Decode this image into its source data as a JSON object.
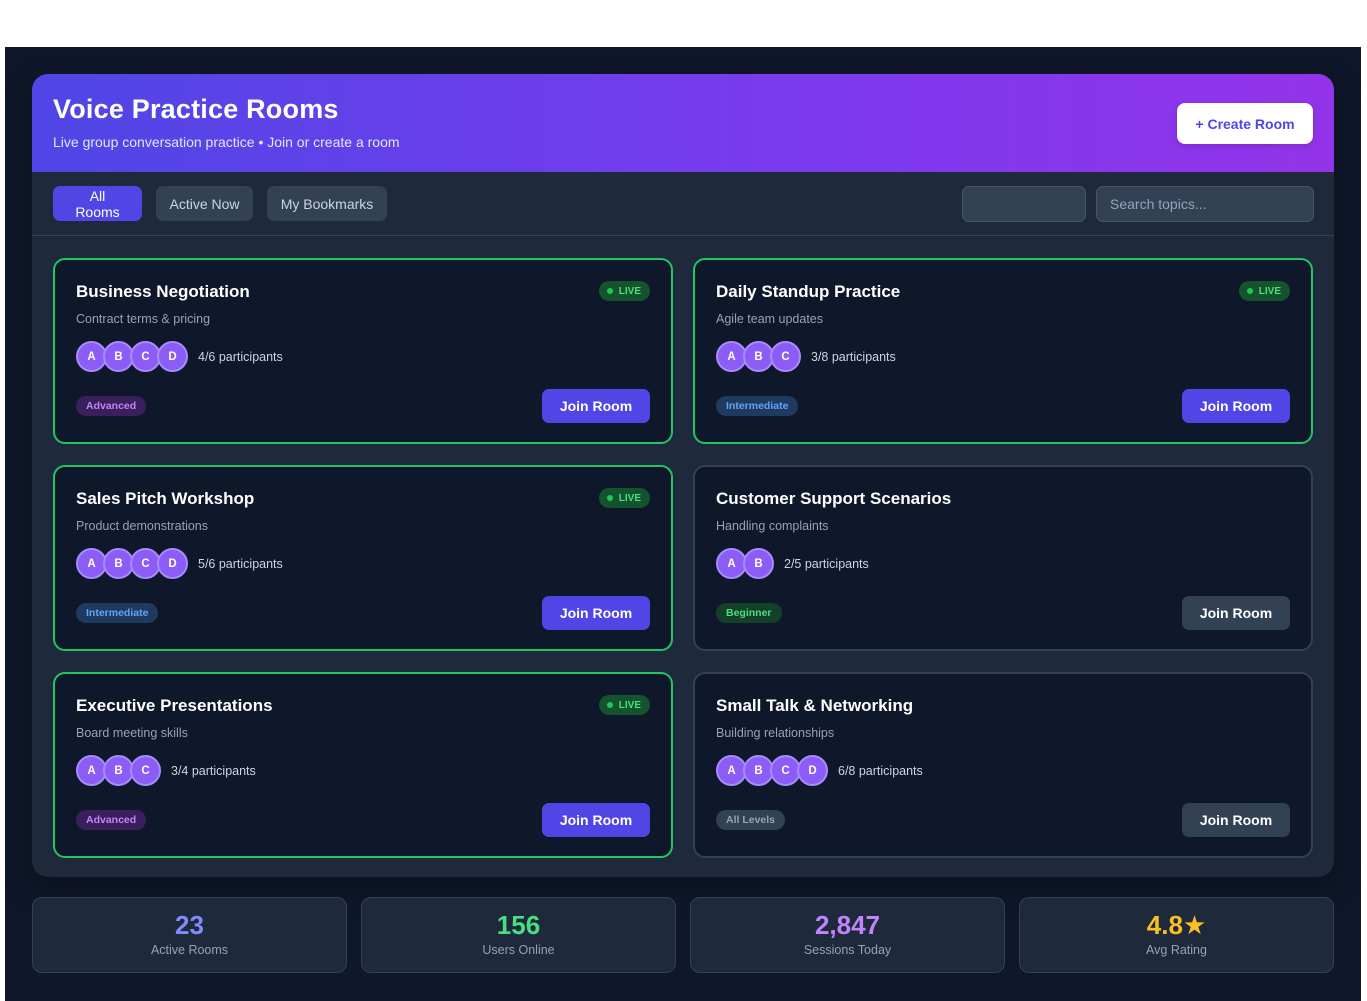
{
  "header": {
    "title": "Voice Practice Rooms",
    "subtitle": "Live group conversation practice • Join or create a room",
    "create_label": "+ Create Room"
  },
  "tabs": [
    {
      "label": "All Rooms",
      "active": true
    },
    {
      "label": "Active Now",
      "active": false
    },
    {
      "label": "My Bookmarks",
      "active": false
    }
  ],
  "search": {
    "placeholder": "Search topics..."
  },
  "live_label": "LIVE",
  "join_label": "Join Room",
  "rooms": [
    {
      "title": "Business Negotiation",
      "desc": "Contract terms & pricing",
      "avatars": [
        "A",
        "B",
        "C",
        "D"
      ],
      "participants": "4/6 participants",
      "level": "Advanced",
      "live": true
    },
    {
      "title": "Daily Standup Practice",
      "desc": "Agile team updates",
      "avatars": [
        "A",
        "B",
        "C"
      ],
      "participants": "3/8 participants",
      "level": "Intermediate",
      "live": true
    },
    {
      "title": "Sales Pitch Workshop",
      "desc": "Product demonstrations",
      "avatars": [
        "A",
        "B",
        "C",
        "D"
      ],
      "participants": "5/6 participants",
      "level": "Intermediate",
      "live": true
    },
    {
      "title": "Customer Support Scenarios",
      "desc": "Handling complaints",
      "avatars": [
        "A",
        "B"
      ],
      "participants": "2/5 participants",
      "level": "Beginner",
      "live": false
    },
    {
      "title": "Executive Presentations",
      "desc": "Board meeting skills",
      "avatars": [
        "A",
        "B",
        "C"
      ],
      "participants": "3/4 participants",
      "level": "Advanced",
      "live": true
    },
    {
      "title": "Small Talk & Networking",
      "desc": "Building relationships",
      "avatars": [
        "A",
        "B",
        "C",
        "D"
      ],
      "participants": "6/8 participants",
      "level": "All Levels",
      "live": false
    }
  ],
  "stats": [
    {
      "value": "23",
      "label": "Active Rooms",
      "color": "#818cf8"
    },
    {
      "value": "156",
      "label": "Users Online",
      "color": "#4ade80"
    },
    {
      "value": "2,847",
      "label": "Sessions Today",
      "color": "#c084fc"
    },
    {
      "value": "4.8★",
      "label": "Avg Rating",
      "color": "#fbbf24"
    }
  ]
}
